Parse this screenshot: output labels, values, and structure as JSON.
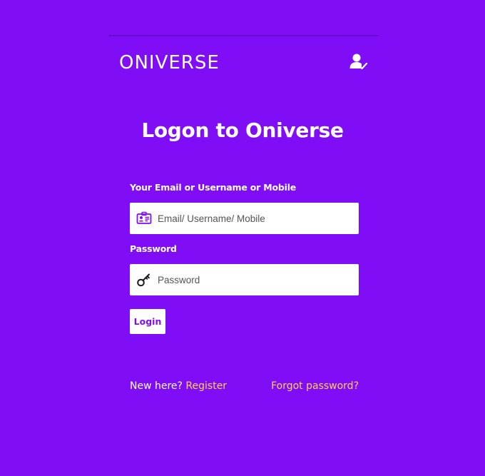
{
  "header": {
    "logo_text": "ONIVERSE",
    "user_icon": "user-check-icon"
  },
  "title": "Logon to Oniverse",
  "form": {
    "identity_label": "Your Email or Username or Mobile",
    "identity_placeholder": "Email/ Username/ Mobile",
    "identity_value": "",
    "identity_icon": "id-card-icon",
    "password_label": "Password",
    "password_placeholder": "Password",
    "password_value": "",
    "password_icon": "key-icon",
    "login_label": "Login"
  },
  "footer": {
    "new_here_text": "New here?",
    "register_label": "Register",
    "forgot_label": "Forgot password?"
  },
  "colors": {
    "background": "#7f0df5",
    "link": "#ffd24a",
    "button_text": "#7f0df5"
  }
}
